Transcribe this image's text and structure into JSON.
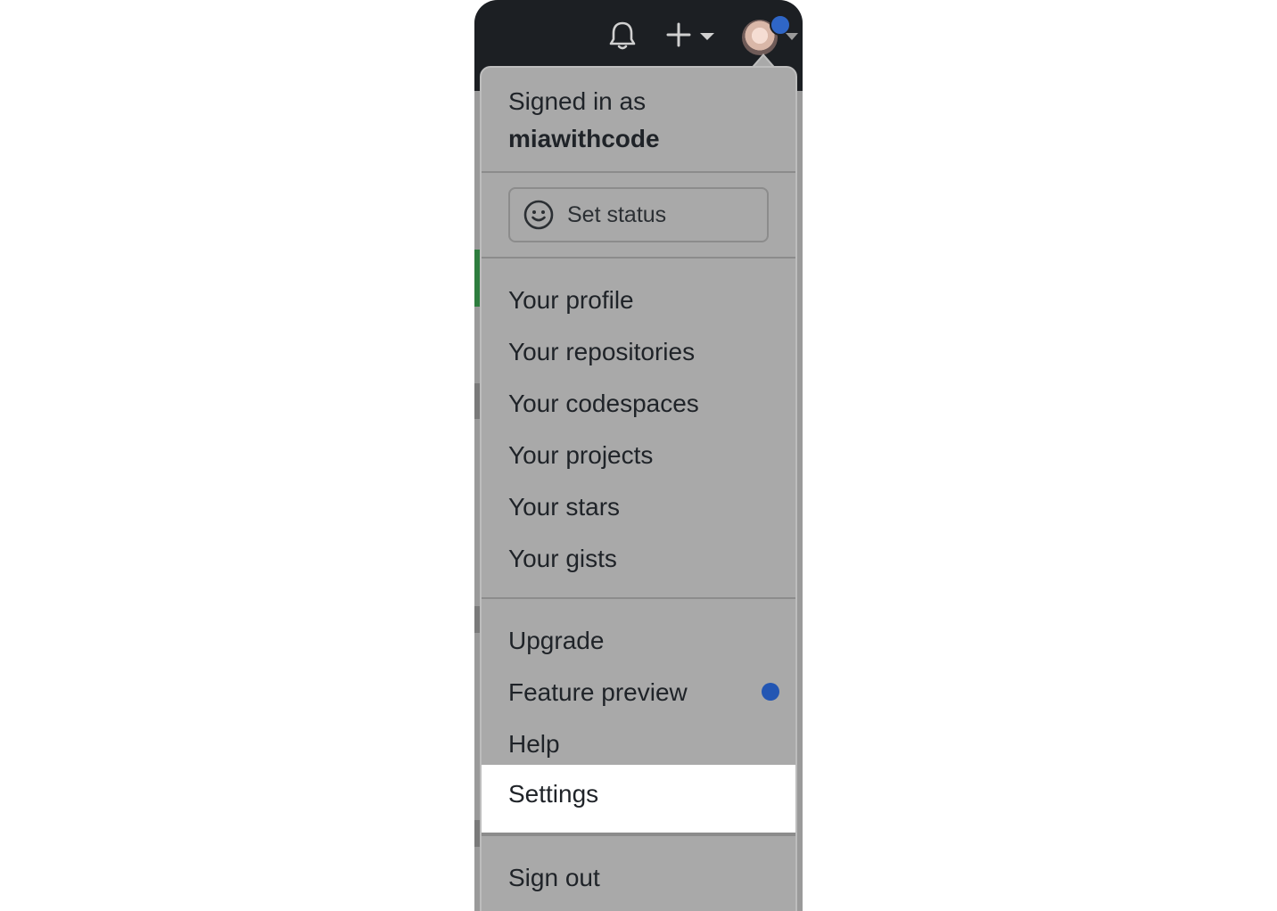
{
  "header": {
    "icons": [
      "bell-icon",
      "plus-icon",
      "chevron-down-icon",
      "avatar"
    ],
    "avatar_badge_color": "#2f66c7"
  },
  "menu": {
    "signed_in_prefix": "Signed in as",
    "username": "miawithcode",
    "status_button": {
      "icon": "smiley-icon",
      "label": "Set status"
    },
    "group1": [
      "Your profile",
      "Your repositories",
      "Your codespaces",
      "Your projects",
      "Your stars",
      "Your gists"
    ],
    "group2": [
      "Upgrade",
      "Feature preview",
      "Help",
      "Settings"
    ],
    "feature_preview_badge_color": "#2356b3",
    "highlighted_item": "Settings",
    "sign_out": "Sign out"
  }
}
